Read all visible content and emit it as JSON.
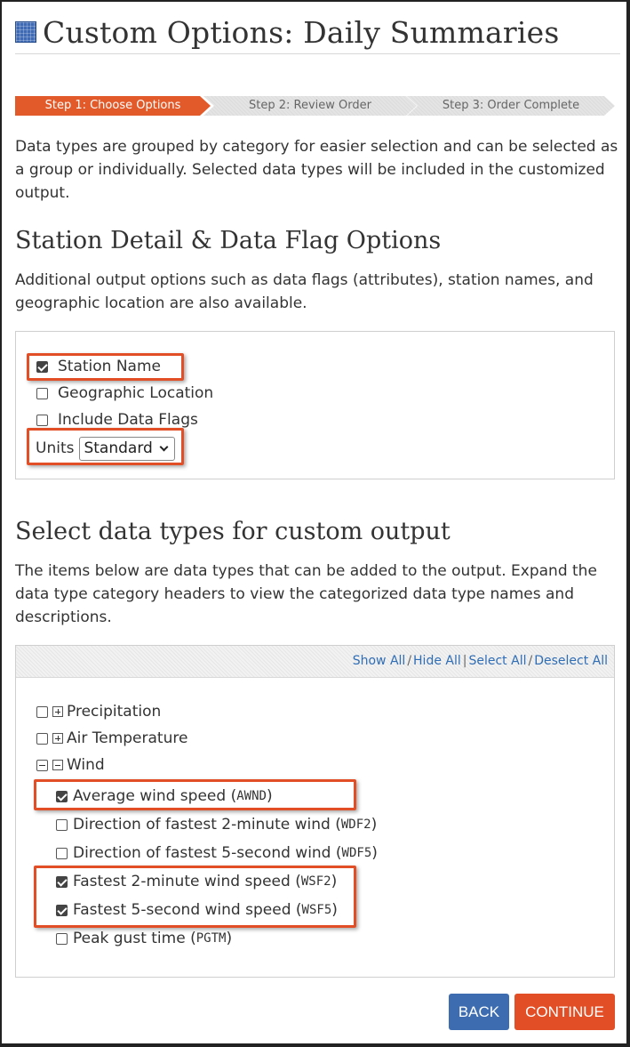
{
  "title": "Custom Options: Daily Summaries",
  "steps": [
    "Step 1: Choose Options",
    "Step 2: Review Order",
    "Step 3: Order Complete"
  ],
  "intro": "Data types are grouped by category for easier selection and can be selected as a group or individually. Selected data types will be included in the customized output.",
  "station_section": {
    "heading": "Station Detail & Data Flag Options",
    "description": "Additional output options such as data flags (attributes), station names, and geographic location are also available.",
    "options": [
      {
        "label": "Station Name",
        "checked": true
      },
      {
        "label": "Geographic Location",
        "checked": false
      },
      {
        "label": "Include Data Flags",
        "checked": false
      }
    ],
    "units_label": "Units",
    "units_value": "Standard"
  },
  "datatypes_section": {
    "heading": "Select data types for custom output",
    "description": "The items below are data types that can be added to the output. Expand the data type category headers to view the categorized data type names and descriptions.",
    "toolbar": {
      "show_all": "Show All",
      "hide_all": "Hide All",
      "select_all": "Select All",
      "deselect_all": "Deselect All",
      "sep_slash": "/",
      "sep_bar": "|"
    },
    "categories": [
      {
        "label": "Precipitation",
        "expanded": false,
        "checked": false
      },
      {
        "label": "Air Temperature",
        "expanded": false,
        "checked": false
      },
      {
        "label": "Wind",
        "expanded": true,
        "checked": false
      }
    ],
    "wind_items": [
      {
        "label": "Average wind speed",
        "code": "AWND",
        "checked": true
      },
      {
        "label": "Direction of fastest 2-minute wind",
        "code": "WDF2",
        "checked": false
      },
      {
        "label": "Direction of fastest 5-second wind",
        "code": "WDF5",
        "checked": false
      },
      {
        "label": "Fastest 2-minute wind speed",
        "code": "WSF2",
        "checked": true
      },
      {
        "label": "Fastest 5-second wind speed",
        "code": "WSF5",
        "checked": true
      },
      {
        "label": "Peak gust time",
        "code": "PGTM",
        "checked": false
      }
    ]
  },
  "buttons": {
    "back": "BACK",
    "continue": "CONTINUE"
  },
  "colors": {
    "accent": "#e35a2a",
    "link": "#2f6db5",
    "back_button": "#3d6db0",
    "highlight": "#e24e26"
  }
}
